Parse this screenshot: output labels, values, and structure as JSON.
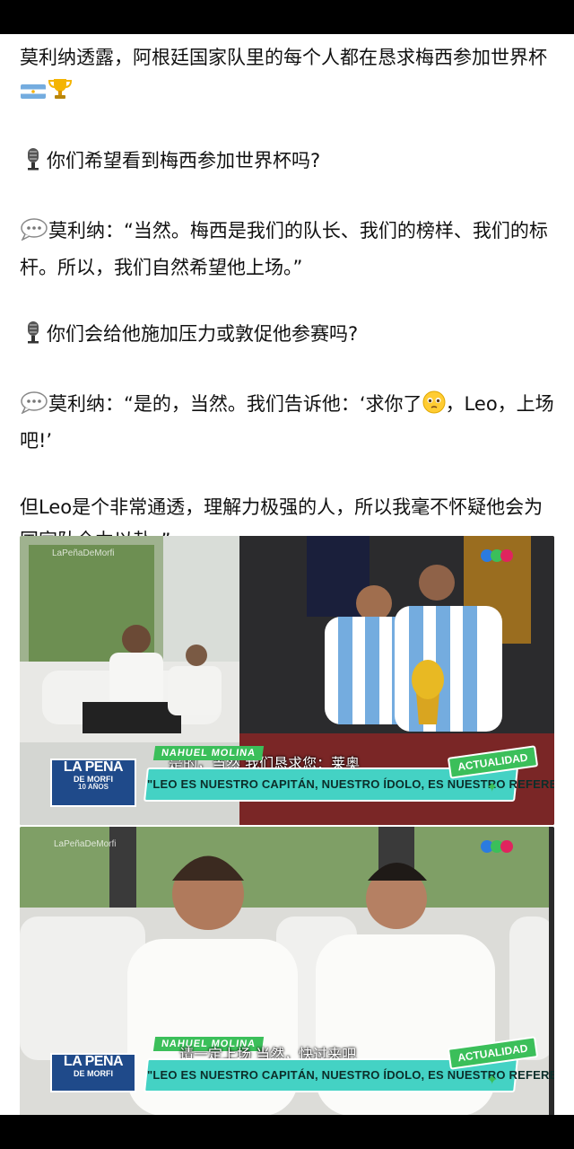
{
  "post": {
    "paragraphs": [
      {
        "text": "莫利纳透露，阿根廷国家队里的每个人都在恳求梅西参加世界杯",
        "trailing_icons": [
          "argentina-flag-icon",
          "trophy-icon"
        ]
      },
      {
        "leading_icon": "microphone-icon",
        "text": "你们希望看到梅西参加世界杯吗?"
      },
      {
        "leading_icon": "speech-bubble-icon",
        "text": "莫利纳：“当然。梅西是我们的队长、我们的榜样、我们的标杆。所以，我们自然希望他上场。”"
      },
      {
        "leading_icon": "microphone-icon",
        "text": "你们会给他施加压力或敦促他参赛吗?"
      },
      {
        "leading_icon": "speech-bubble-icon",
        "text_before": "莫利纳：“是的，当然。我们告诉他：‘求你了",
        "inline_icon": "pleading-face-icon",
        "text_after": "，Leo，上场吧!’"
      },
      {
        "text": "但Leo是个非常通透，理解力极强的人，所以我毫不怀疑他会为国家队全力以赴。”"
      }
    ]
  },
  "figures": [
    {
      "subtitle": "是的，当然  我们恳求您：莱奥",
      "caption": "\"LEO ES NUESTRO CAPITÁN, NUESTRO ÍDOLO, ES NUESTRO REFERENTE\"",
      "name_tag": "NAHUEL MOLINA",
      "badge": "ACTUALIDAD",
      "logo": {
        "line1": "LA PEÑA",
        "line2": "DE MORFI",
        "line3": "10 AÑOS"
      },
      "watermark": "LaPeñaDeMorfi"
    },
    {
      "subtitle": "请一定上场  当然，快过来吧",
      "caption": "\"LEO ES NUESTRO CAPITÁN, NUESTRO ÍDOLO, ES NUESTRO REFERENTE\"",
      "name_tag": "NAHUEL MOLINA",
      "badge": "ACTUALIDAD",
      "logo": {
        "line1": "LA PEÑA",
        "line2": "DE MORFI"
      },
      "watermark": "LaPeñaDeMorfi"
    }
  ],
  "colors": {
    "caption_bar": "#44d2c4",
    "badge_green": "#3bbf5a",
    "logo_blue": "#1f4a8a",
    "channel_dots": [
      "#2b7be0",
      "#3bbf5a",
      "#e0245e"
    ]
  }
}
